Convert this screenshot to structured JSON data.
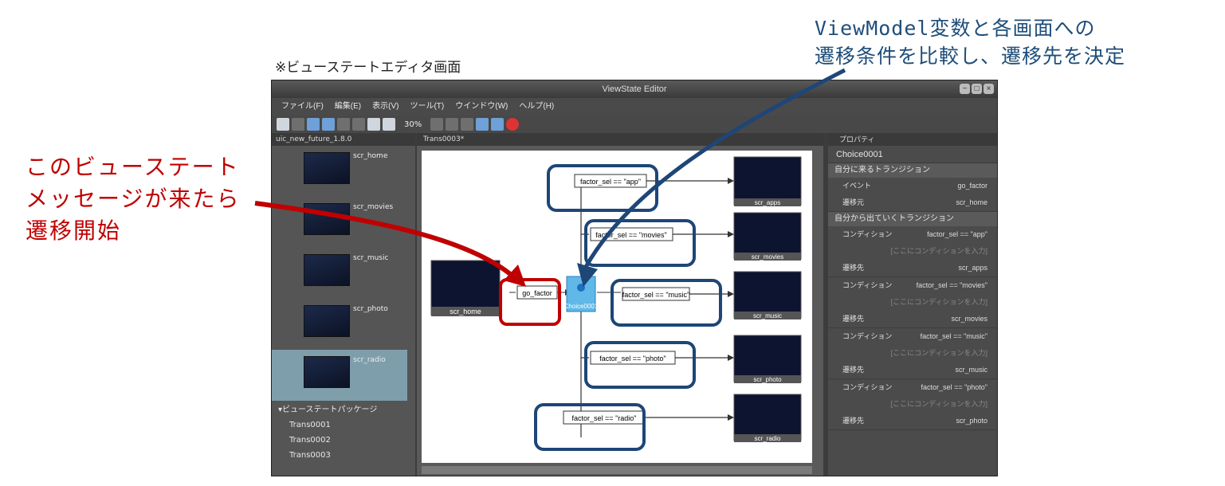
{
  "annotations": {
    "top_line1": "ViewModel変数と各画面への",
    "top_line2": "遷移条件を比較し、遷移先を決定",
    "left_line1": "このビューステート",
    "left_line2": "メッセージが来たら",
    "left_line3": "遷移開始",
    "caption": "※ビューステートエディタ画面"
  },
  "colors": {
    "annot_blue": "#1f4e79",
    "annot_red": "#c00000",
    "highlight_blue": "#1e4677",
    "highlight_red": "#c00000"
  },
  "window": {
    "title": "ViewState Editor"
  },
  "menu": [
    "ファイル(F)",
    "編集(E)",
    "表示(V)",
    "ツール(T)",
    "ウインドウ(W)",
    "ヘルプ(H)"
  ],
  "toolbar": {
    "zoom": "30%"
  },
  "left_panel": {
    "tab": "uic_new_future_1.8.0",
    "screens": [
      "scr_home",
      "scr_movies",
      "scr_music",
      "scr_photo",
      "scr_radio"
    ],
    "package_header": "ビューステートパッケージ",
    "packages": [
      "Trans0001",
      "Trans0002",
      "Trans0003"
    ]
  },
  "center_panel": {
    "tab": "Trans0003*",
    "nodes": {
      "source": "scr_home",
      "trigger": "go_factor",
      "choice": "Choice0001"
    },
    "branches": [
      {
        "cond": "factor_sel == \"app\"",
        "target": "scr_apps"
      },
      {
        "cond": "factor_sel == \"movies\"",
        "target": "scr_movies"
      },
      {
        "cond": "factor_sel == \"music\"",
        "target": "scr_music"
      },
      {
        "cond": "factor_sel == \"photo\"",
        "target": "scr_photo"
      },
      {
        "cond": "factor_sel == \"radio\"",
        "target": "scr_radio"
      }
    ]
  },
  "properties": {
    "tab": "プロパティ",
    "title": "Choice0001",
    "incoming_header": "自分に来るトランジション",
    "incoming": [
      {
        "k": "イベント",
        "v": "go_factor"
      },
      {
        "k": "遷移元",
        "v": "scr_home"
      }
    ],
    "outgoing_header": "自分から出ていくトランジション",
    "outgoing": [
      {
        "cond": "factor_sel == \"app\"",
        "dest": "scr_apps"
      },
      {
        "cond": "factor_sel == \"movies\"",
        "dest": "scr_movies"
      },
      {
        "cond": "factor_sel == \"music\"",
        "dest": "scr_music"
      },
      {
        "cond": "factor_sel == \"photo\"",
        "dest": "scr_photo"
      }
    ],
    "cond_label": "コンディション",
    "cond_hint": "[ここにコンディションを入力]",
    "dest_label": "遷移先"
  }
}
